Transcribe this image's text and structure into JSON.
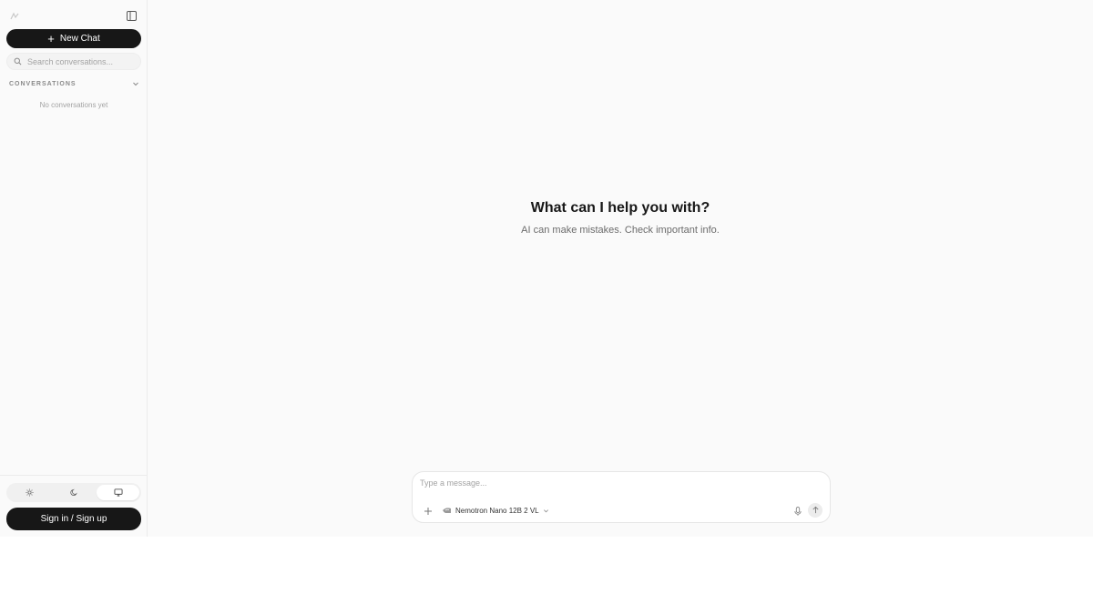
{
  "sidebar": {
    "logo_icon": "app-logo-icon",
    "collapse_icon": "sidebar-toggle-icon",
    "new_chat_label": "New Chat",
    "search": {
      "placeholder": "Search conversations..."
    },
    "conversations_heading": "CONVERSATIONS",
    "empty_state": "No conversations yet",
    "theme_options": [
      "light",
      "dark",
      "system"
    ],
    "theme_selected": "system",
    "sign_in_label": "Sign in / Sign up"
  },
  "main": {
    "title": "What can I help you with?",
    "subtitle": "AI can make mistakes. Check important info.",
    "composer": {
      "placeholder": "Type a message...",
      "model_name": "Nemotron Nano 12B 2 VL"
    }
  },
  "colors": {
    "background": "#fafafa",
    "primary_button": "#171717",
    "muted_text": "#a3a3a3"
  }
}
